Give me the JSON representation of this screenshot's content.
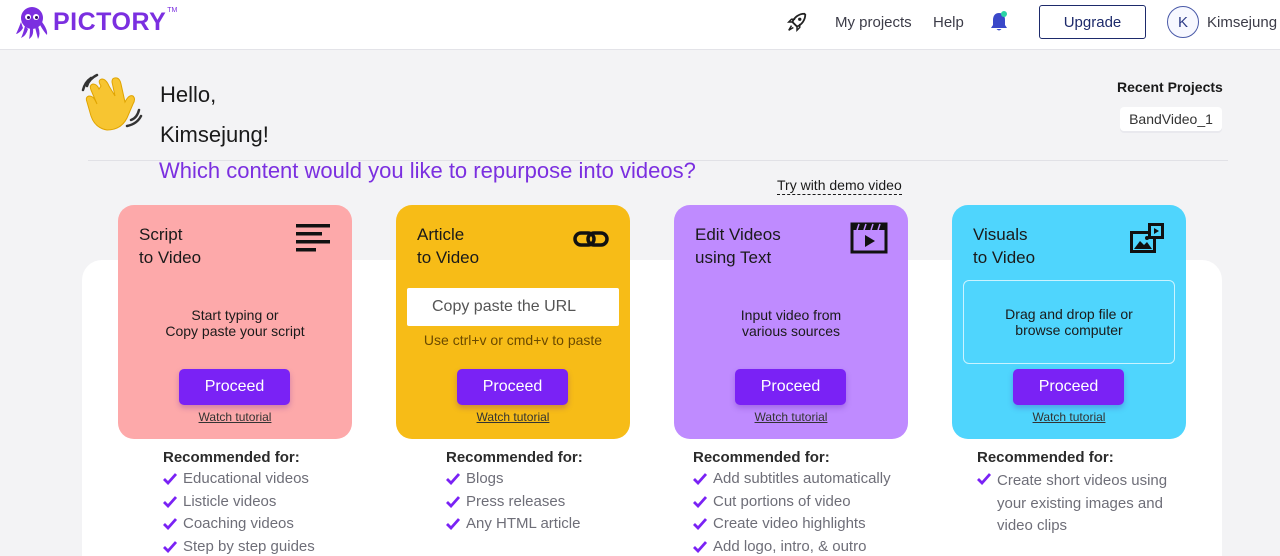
{
  "header": {
    "logo_text": "PICTORY",
    "logo_tm": "TM",
    "nav": {
      "projects": "My projects",
      "help": "Help"
    },
    "upgrade_label": "Upgrade",
    "avatar_initial": "K",
    "username": "Kimsejung"
  },
  "greeting": {
    "hello": "Hello,",
    "name": "Kimsejung!",
    "question": "Which content would you like to repurpose into videos?",
    "demo_link": "Try with demo video"
  },
  "recent": {
    "title": "Recent Projects",
    "items": [
      "BandVideo_1"
    ]
  },
  "cards": [
    {
      "title_1": "Script",
      "title_2": "to Video",
      "icon": "text-lines-icon",
      "body_1": "Start typing or",
      "body_2": "Copy paste your script",
      "proceed": "Proceed",
      "watch": "Watch tutorial",
      "color": "#fda9aa"
    },
    {
      "title_1": "Article",
      "title_2": "to Video",
      "icon": "link-icon",
      "input_placeholder": "Copy paste the URL",
      "hint": "Use ctrl+v or cmd+v to paste",
      "proceed": "Proceed",
      "watch": "Watch tutorial",
      "color": "#f7bc17"
    },
    {
      "title_1": "Edit Videos",
      "title_2": "using Text",
      "icon": "video-player-icon",
      "body_1": "Input video from",
      "body_2": "various sources",
      "proceed": "Proceed",
      "watch": "Watch tutorial",
      "color": "#bf8bff"
    },
    {
      "title_1": "Visuals",
      "title_2": "to Video",
      "icon": "images-icon",
      "body_1": "Drag and drop file or",
      "body_2": "browse computer",
      "proceed": "Proceed",
      "watch": "Watch tutorial",
      "color": "#4fd5fd"
    }
  ],
  "recommended": [
    {
      "title": "Recommended for:",
      "items": [
        "Educational videos",
        "Listicle videos",
        "Coaching videos",
        "Step by step guides"
      ]
    },
    {
      "title": "Recommended for:",
      "items": [
        "Blogs",
        "Press releases",
        "Any HTML article"
      ]
    },
    {
      "title": "Recommended for:",
      "items": [
        "Add subtitles automatically",
        "Cut portions of video",
        "Create video highlights",
        "Add logo, intro, & outro"
      ]
    },
    {
      "title": "Recommended for:",
      "items": [
        "Create short videos using",
        "your existing images and",
        "video clips"
      ]
    }
  ],
  "colors": {
    "brand": "#7b2fe0",
    "proceed": "#7a22f5",
    "check": "#7a22f5"
  }
}
